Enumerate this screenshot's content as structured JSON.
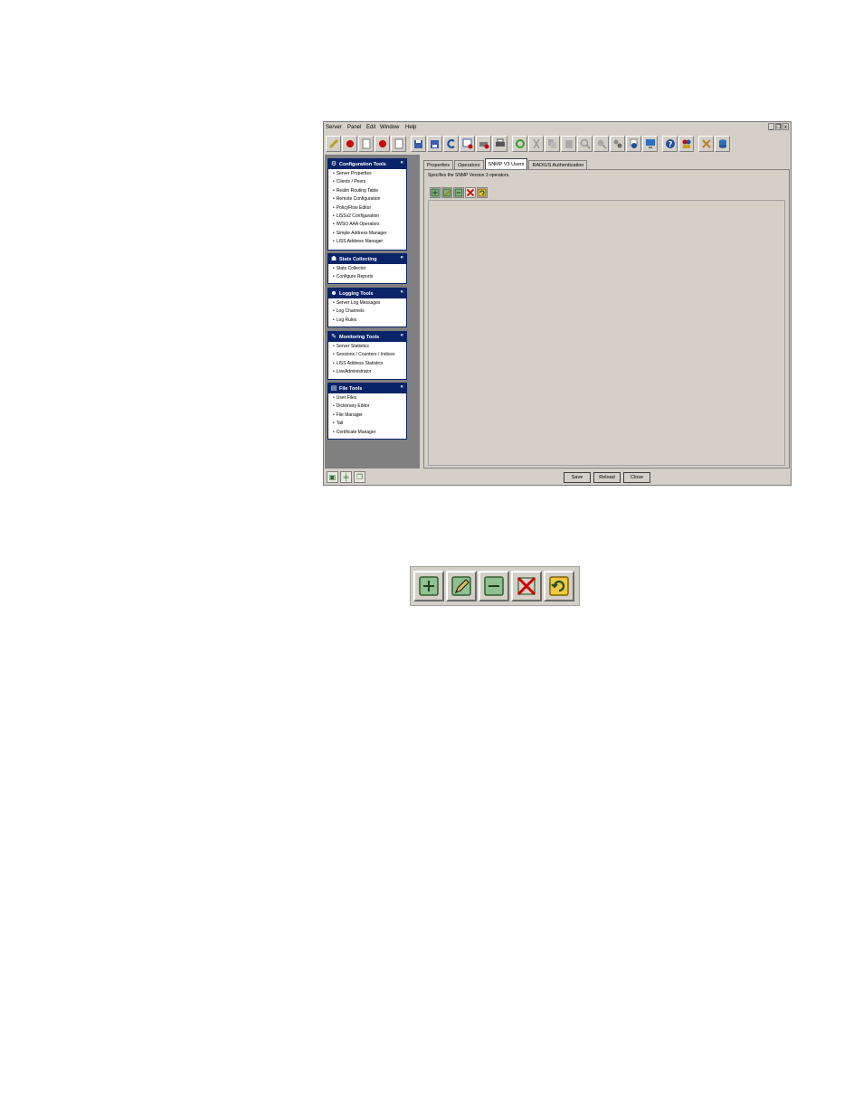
{
  "menu": [
    "Server",
    "Panel",
    "Edit",
    "Window",
    "Help"
  ],
  "window_controls": [
    "_",
    "❐",
    "x"
  ],
  "toolbar_icons": [
    "connect-icon",
    "record-red-icon",
    "document-icon",
    "record-red-icon",
    "document-icon",
    "save-icon",
    "save-all-icon",
    "refresh-icon",
    "window-remove-icon",
    "printer-remove-icon",
    "printer-icon",
    "link-icon",
    "cut-icon",
    "copy-icon",
    "paste-icon",
    "find-icon",
    "find-next-icon",
    "gears-icon",
    "clock-icon",
    "monitor-icon",
    "help-icon",
    "users-icon",
    "tools-icon",
    "database-icon"
  ],
  "sidebar": {
    "panels": [
      {
        "title": "Configuration Tools",
        "icon": "config-tools-icon",
        "items": [
          "Server Properties",
          "Clients / Peers",
          "Realm Routing Table",
          "Remote Configuration",
          "PolicyFlow Editor",
          "LISSv2 Configuration",
          "IWSO AAA Operators",
          "Simple Address Manager",
          "LISS Address Manager"
        ]
      },
      {
        "title": "Stats Collecting",
        "icon": "stats-collecting-icon",
        "items": [
          "Stats Collector",
          "Configure Reports"
        ]
      },
      {
        "title": "Logging Tools",
        "icon": "logging-tools-icon",
        "items": [
          "Server Log Messages",
          "Log Channels",
          "Log Rules"
        ]
      },
      {
        "title": "Monitoring Tools",
        "icon": "monitoring-tools-icon",
        "items": [
          "Server Statistics",
          "Sessions / Counters / Indices",
          "LISS Address Statistics",
          "LiveAdministrator"
        ]
      },
      {
        "title": "File Tools",
        "icon": "file-tools-icon",
        "items": [
          "User Files",
          "Dictionary Editor",
          "File Manager",
          "Tail",
          "Certificate Manager"
        ]
      }
    ],
    "collapse_glyph": "«"
  },
  "tabs": [
    "Properties",
    "Operators",
    "SNMP V3 Users",
    "RADIUS Authentication"
  ],
  "tab_description": "Specifies the SNMP Version 3 operators.",
  "bottom_buttons": {
    "save": "Save",
    "reload": "Reload",
    "close": "Close"
  },
  "colors": {
    "window_bg": "#d4d0c8",
    "panel_header": "#0a246a",
    "sidebar_bg": "#808080"
  }
}
